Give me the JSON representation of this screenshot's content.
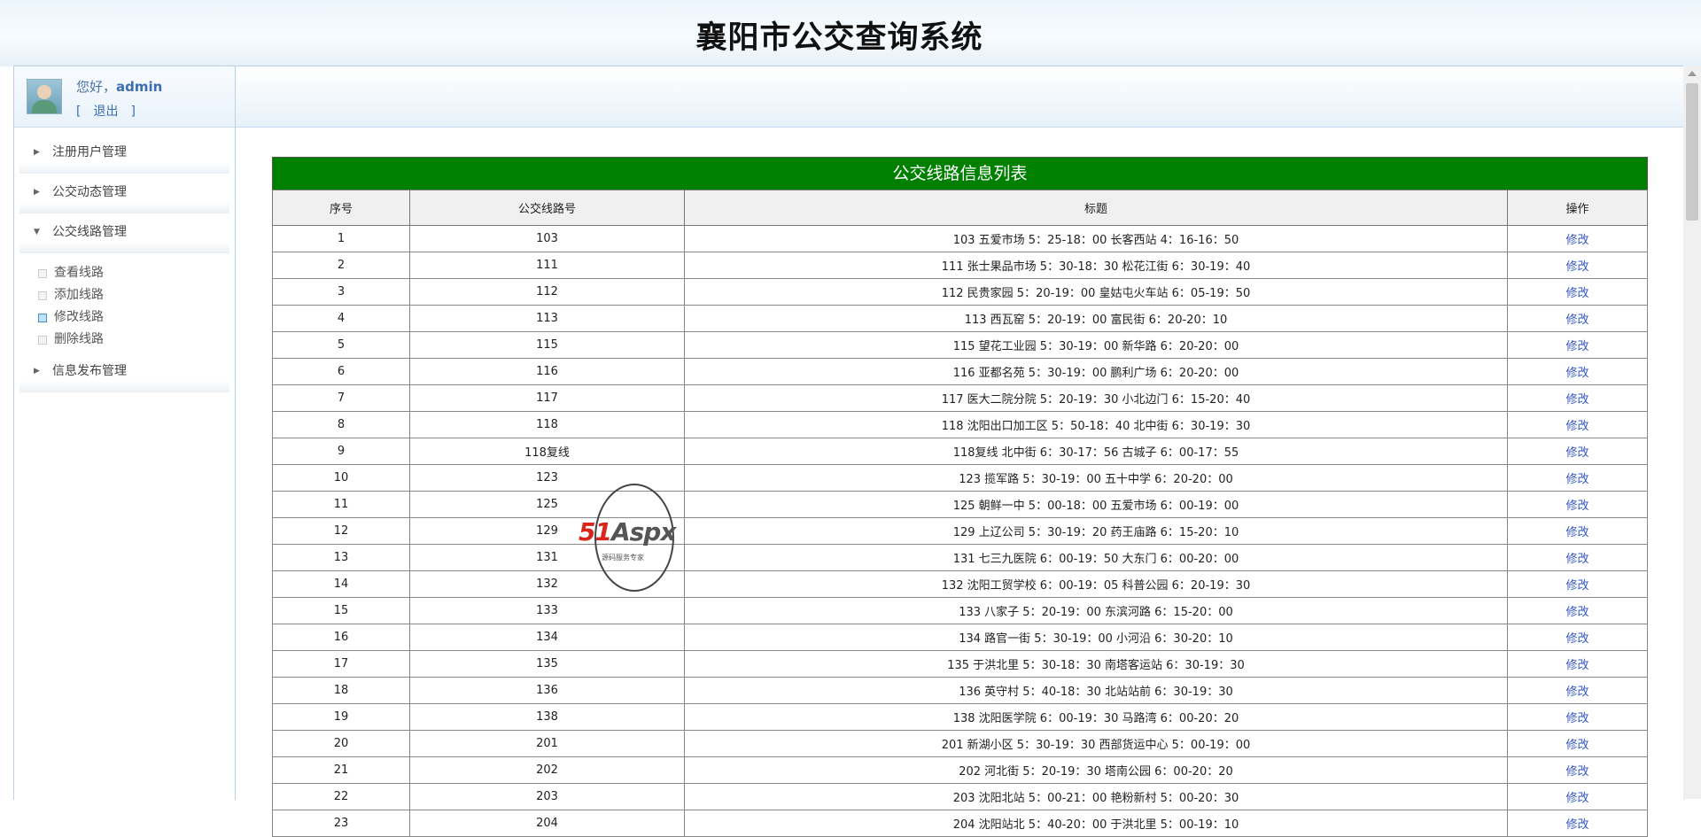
{
  "app": {
    "title": "襄阳市公交查询系统"
  },
  "user": {
    "greeting": "您好，",
    "name": "admin",
    "logout_label": "[　退出　]"
  },
  "sidebar": {
    "menus": [
      {
        "label": "注册用户管理",
        "expanded": false
      },
      {
        "label": "公交动态管理",
        "expanded": false
      },
      {
        "label": "公交线路管理",
        "expanded": true,
        "items": [
          {
            "label": "查看线路",
            "active": false
          },
          {
            "label": "添加线路",
            "active": false
          },
          {
            "label": "修改线路",
            "active": true
          },
          {
            "label": "删除线路",
            "active": false
          }
        ]
      },
      {
        "label": "信息发布管理",
        "expanded": false
      }
    ]
  },
  "table": {
    "caption": "公交线路信息列表",
    "columns": [
      "序号",
      "公交线路号",
      "标题",
      "操作"
    ],
    "action_label": "修改",
    "rows": [
      {
        "no": "1",
        "line": "103",
        "title": "103 五爱市场 5：25-18：00 长客西站 4：16-16：50"
      },
      {
        "no": "2",
        "line": "111",
        "title": "111 张士果品市场 5：30-18：30 松花江街 6：30-19：40"
      },
      {
        "no": "3",
        "line": "112",
        "title": "112 民贵家园 5：20-19：00 皇姑屯火车站 6：05-19：50"
      },
      {
        "no": "4",
        "line": "113",
        "title": "113 西瓦窑 5：20-19：00 富民街 6：20-20：10"
      },
      {
        "no": "5",
        "line": "115",
        "title": "115 望花工业园 5：30-19：00 新华路 6：20-20：00"
      },
      {
        "no": "6",
        "line": "116",
        "title": "116 亚都名苑 5：30-19：00 鹏利广场 6：20-20：00"
      },
      {
        "no": "7",
        "line": "117",
        "title": "117 医大二院分院 5：20-19：30 小北边门 6：15-20：40"
      },
      {
        "no": "8",
        "line": "118",
        "title": "118 沈阳出口加工区 5：50-18：40 北中街 6：30-19：30"
      },
      {
        "no": "9",
        "line": "118复线",
        "title": "118复线 北中街 6：30-17：56 古城子 6：00-17：55"
      },
      {
        "no": "10",
        "line": "123",
        "title": "123 揽军路 5：30-19：00 五十中学 6：20-20：00"
      },
      {
        "no": "11",
        "line": "125",
        "title": "125 朝鲜一中 5：00-18：00 五爱市场 6：00-19：00"
      },
      {
        "no": "12",
        "line": "129",
        "title": "129 上辽公司 5：30-19：20 药王庙路 6：15-20：10"
      },
      {
        "no": "13",
        "line": "131",
        "title": "131 七三九医院 6：00-19：50 大东门 6：00-20：00"
      },
      {
        "no": "14",
        "line": "132",
        "title": "132 沈阳工贸学校 6：00-19：05 科普公园 6：20-19：30"
      },
      {
        "no": "15",
        "line": "133",
        "title": "133 八家子 5：20-19：00 东滨河路 6：15-20：00"
      },
      {
        "no": "16",
        "line": "134",
        "title": "134 路官一街 5：30-19：00 小河沿 6：30-20：10"
      },
      {
        "no": "17",
        "line": "135",
        "title": "135 于洪北里 5：30-18：30 南塔客运站 6：30-19：30"
      },
      {
        "no": "18",
        "line": "136",
        "title": "136 英守村 5：40-18：30 北站站前 6：30-19：30"
      },
      {
        "no": "19",
        "line": "138",
        "title": "138 沈阳医学院 6：00-19：30 马路湾 6：00-20：20"
      },
      {
        "no": "20",
        "line": "201",
        "title": "201 新湖小区 5：30-19：30 西部货运中心 5：00-19：00"
      },
      {
        "no": "21",
        "line": "202",
        "title": "202 河北街 5：20-19：30 塔南公园 6：00-20：20"
      },
      {
        "no": "22",
        "line": "203",
        "title": "203 沈阳北站 5：00-21：00 艳粉新村 5：00-20：30"
      },
      {
        "no": "23",
        "line": "204",
        "title": "204 沈阳站北 5：40-20：00 于洪北里 5：00-19：10"
      }
    ]
  },
  "watermark": {
    "brand_a": "51",
    "brand_b": "Aspx",
    "tagline": "源码服务专家"
  }
}
